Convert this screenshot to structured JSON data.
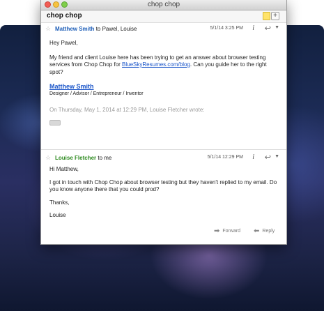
{
  "window": {
    "title": "chop chop"
  },
  "subject": "chop chop",
  "messages": [
    {
      "sender": "Matthew Smith",
      "recipients": "to Pawel, Louise",
      "date": "5/1/14 3:25 PM",
      "greeting": "Hey Pawel,",
      "body_before_link": "My friend and client Louise here has been trying to get an answer about browser testing services from Chop Chop for ",
      "link": "BlueSkyResumes.com/blog",
      "body_after_link": ". Can you guide her to the right spot?",
      "signature_name": "Matthew Smith",
      "signature_title": "Designer / Advisor / Entrepreneur / Inventor",
      "quote_header": "On Thursday, May 1, 2014 at 12:29 PM, Louise Fletcher wrote:"
    },
    {
      "sender": "Louise Fletcher",
      "recipients": "to me",
      "date": "5/1/14 12:29 PM",
      "greeting": "Hi Matthew,",
      "body": "I got in touch with Chop Chop about browser testing but they haven't replied to my email. Do you know anyone there that you could prod?",
      "thanks": "Thanks,",
      "signoff": "Louise"
    }
  ],
  "actions": {
    "forward": "Forward",
    "reply": "Reply"
  },
  "icons": {
    "star": "☆",
    "info": "i",
    "reply": "↩",
    "chevron": "▼",
    "forward_arrow": "➡",
    "reply_arrow": "⬅",
    "plus": "+"
  },
  "colors": {
    "sender_blue": "#1f5fb8",
    "sender_green": "#2d8a1f",
    "link": "#1a55c9"
  }
}
